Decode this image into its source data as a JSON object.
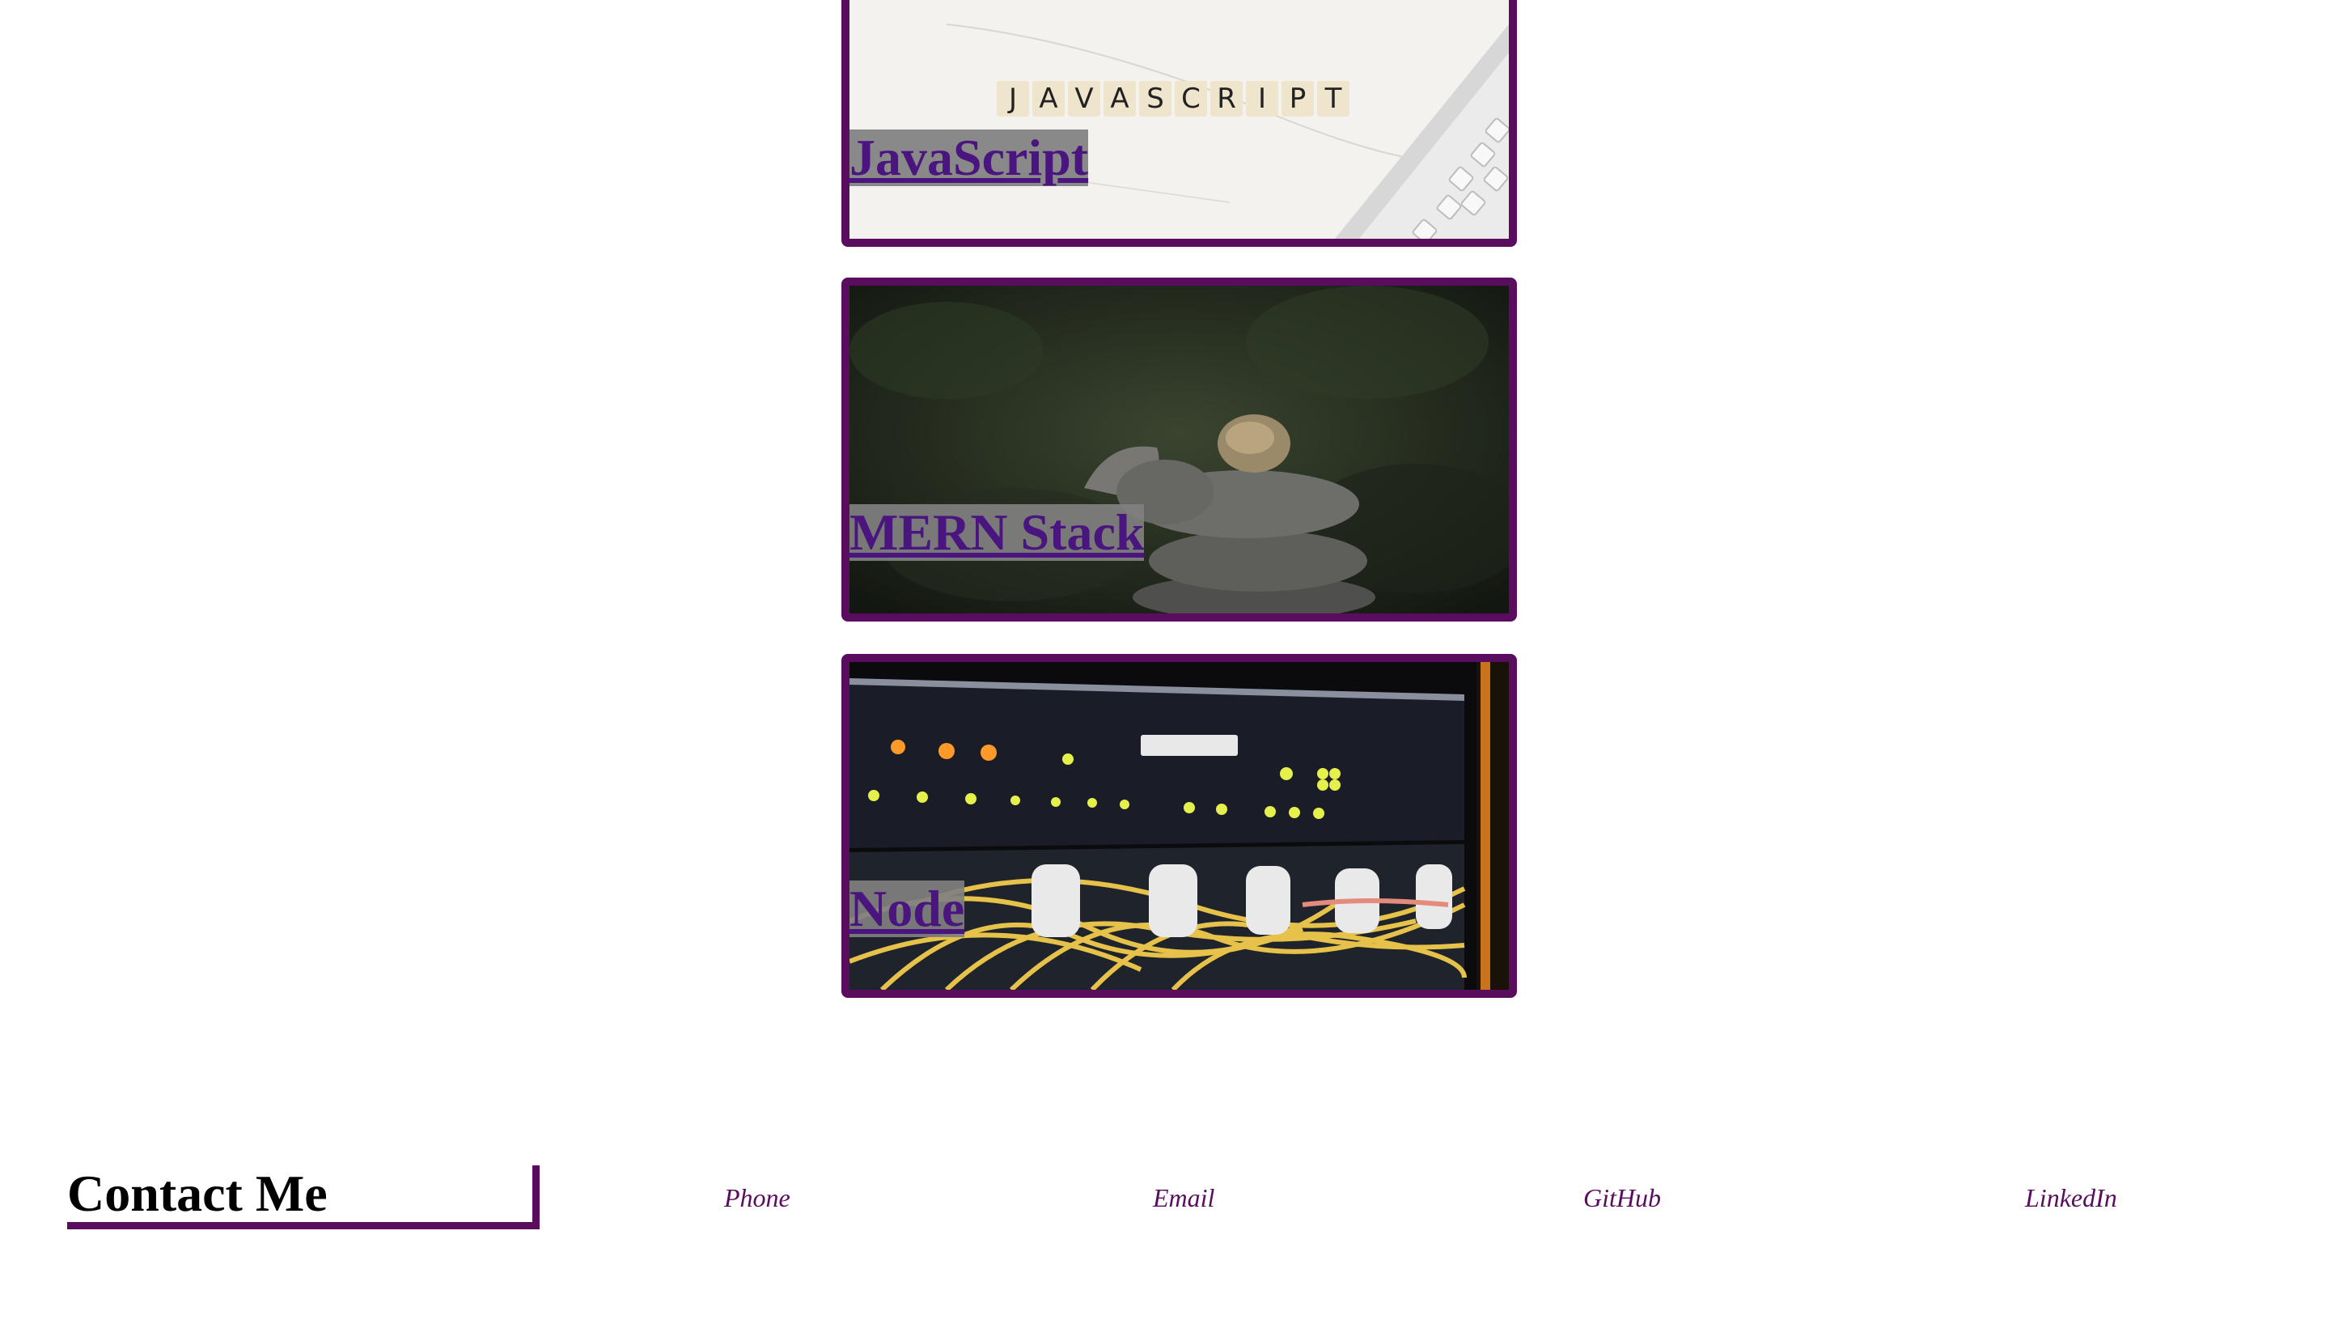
{
  "projects": [
    {
      "title": "JavaScript",
      "image": "javascript-letter-tiles-photo"
    },
    {
      "title": "MERN Stack",
      "image": "stacked-rocks-photo"
    },
    {
      "title": "Node",
      "image": "network-server-cables-photo"
    }
  ],
  "footer": {
    "heading": "Contact Me",
    "links": {
      "phone": "Phone",
      "email": "Email",
      "github": "GitHub",
      "linkedin": "LinkedIn"
    }
  },
  "colors": {
    "accent": "#5a0c5f",
    "link": "#4b1580",
    "label_bg": "#808080"
  }
}
